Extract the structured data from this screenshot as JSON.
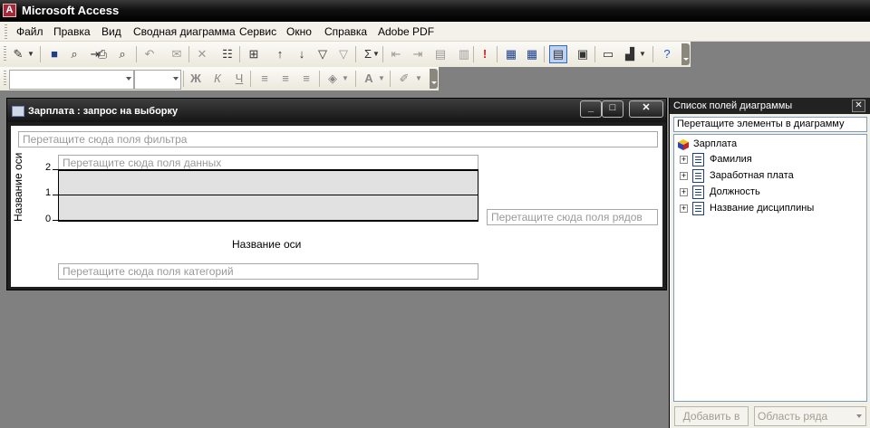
{
  "app": {
    "title": "Microsoft Access"
  },
  "menu": {
    "items": [
      "Файл",
      "Правка",
      "Вид",
      "Сводная диаграмма",
      "Сервис",
      "Окно",
      "Справка",
      "Adobe PDF"
    ]
  },
  "format_toolbar": {
    "font_name": "",
    "font_size": "",
    "bold": "Ж",
    "italic": "К",
    "underline": "Ч",
    "font_color_letter": "A"
  },
  "chart_window": {
    "title": "Зарплата : запрос на выборку",
    "filter_zone": "Перетащите сюда поля фильтра",
    "data_zone": "Перетащите сюда поля данных",
    "series_zone": "Перетащите сюда поля рядов",
    "category_zone": "Перетащите сюда поля категорий",
    "y_axis_title": "Название оси",
    "x_axis_title": "Название оси"
  },
  "chart_data": {
    "type": "bar",
    "categories": [],
    "series": [],
    "title": "",
    "xlabel": "Название оси",
    "ylabel": "Название оси",
    "ylim": [
      0,
      2
    ],
    "yticks": [
      "2",
      "1",
      "0"
    ],
    "grid": true
  },
  "field_list": {
    "title": "Список полей диаграммы",
    "hint": "Перетащите элементы в диаграмму",
    "root": "Зарплата",
    "fields": [
      "Фамилия",
      "Заработная плата",
      "Должность",
      "Название дисциплины"
    ],
    "add_button": "Добавить в",
    "area_select": "Область ряда"
  }
}
